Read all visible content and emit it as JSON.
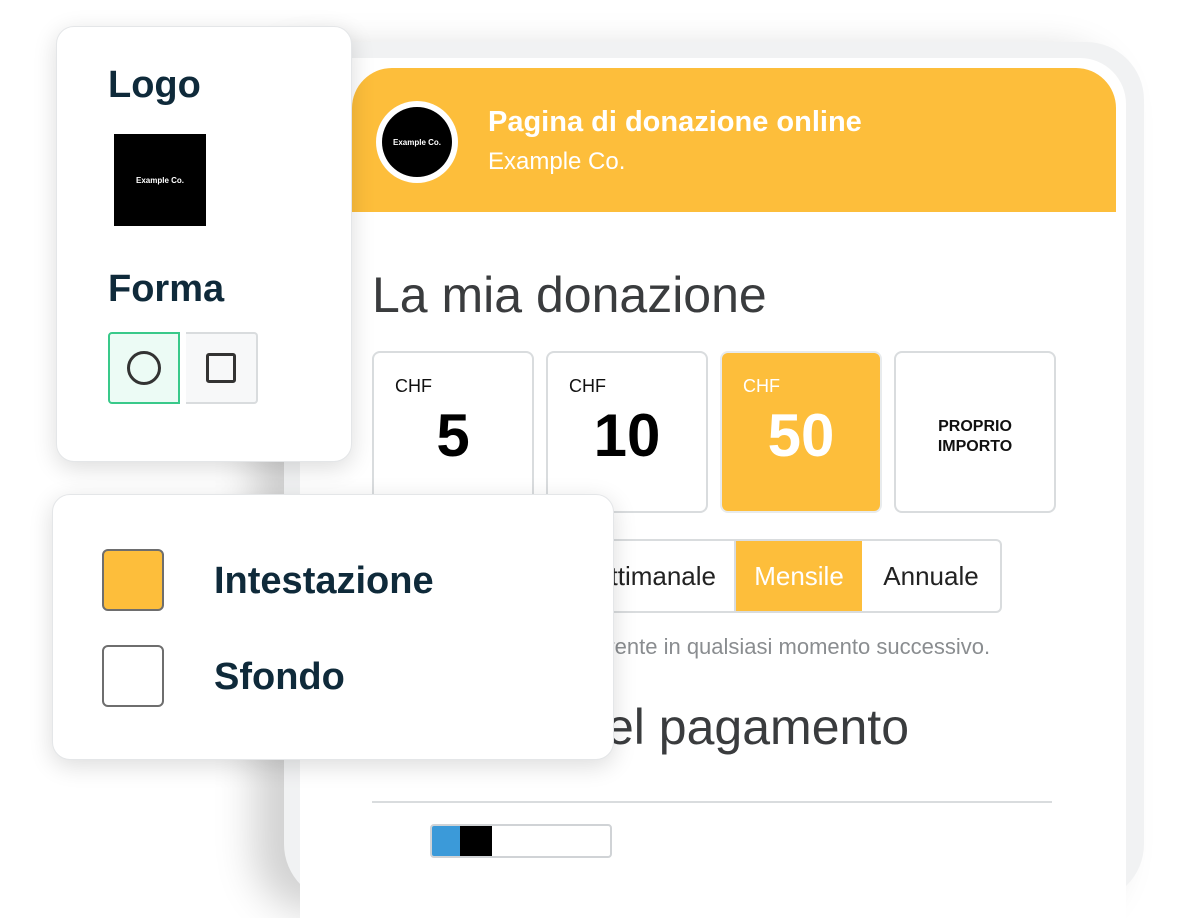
{
  "colors": {
    "accent": "#FDBE3B",
    "white": "#FFFFFF"
  },
  "donation_page": {
    "title": "Pagina di donazione online",
    "organization": "Example Co.",
    "logo_text": "Example Co.",
    "my_donation_heading": "La mia donazione",
    "amounts": [
      {
        "currency": "CHF",
        "value": "5",
        "selected": false
      },
      {
        "currency": "CHF",
        "value": "10",
        "selected": false
      },
      {
        "currency": "CHF",
        "value": "50",
        "selected": true
      }
    ],
    "custom_amount_line1": "PROPRIO",
    "custom_amount_line2": "IMPORTO",
    "frequency": [
      {
        "label": "ttimanale",
        "selected": false
      },
      {
        "label": "Mensile",
        "selected": true
      },
      {
        "label": "Annuale",
        "selected": false
      }
    ],
    "hint_text": "rrente in qualsiasi momento successivo.",
    "payment_heading": "el pagamento"
  },
  "logo_panel": {
    "logo_heading": "Logo",
    "logo_text": "Example Co.",
    "shape_heading": "Forma",
    "shape_options": [
      {
        "icon": "circle-icon",
        "selected": true
      },
      {
        "icon": "square-icon",
        "selected": false
      }
    ]
  },
  "color_panel": {
    "items": [
      {
        "label": "Intestazione",
        "color": "#FDBE3B"
      },
      {
        "label": "Sfondo",
        "color": "#FFFFFF"
      }
    ]
  }
}
